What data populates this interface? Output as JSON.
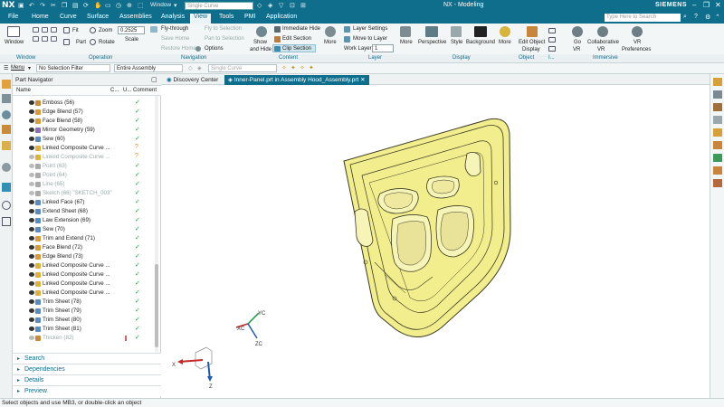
{
  "titlebar": {
    "logo": "NX",
    "window_menu": "Window",
    "curve_filter": "Single Curve",
    "title": "NX - Modeling",
    "brand": "SIEMENS"
  },
  "menu": {
    "tabs": [
      "File",
      "Home",
      "Curve",
      "Surface",
      "Assemblies",
      "Analysis",
      "View",
      "Tools",
      "PMI",
      "Application"
    ],
    "active": "View",
    "search_placeholder": "Type Here to Search"
  },
  "ribbon": {
    "window_label": "Window",
    "fit": "Fit",
    "zoom": "Zoom",
    "scale_value": "0.2525",
    "part": "Part",
    "rotate": "Rotate",
    "scale": "Scale",
    "fly_through": "Fly-through",
    "fly_to_selection": "Fly to Selection",
    "save_home": "Save Home",
    "pan_to_selection": "Pan to Selection",
    "restore_home": "Restore Home",
    "options": "Options",
    "show_and_hide": [
      "Show",
      "and Hide"
    ],
    "immediate_hide": "Immediate Hide",
    "edit_section": "Edit Section",
    "clip_section": "Clip Section",
    "more1": "More",
    "layer_settings": "Layer Settings",
    "move_to_layer": "Move to Layer",
    "work_layer": "Work Layer",
    "work_layer_value": "1",
    "more2": "More",
    "perspective": "Perspective",
    "style": "Style",
    "background": "Background",
    "more3": "More",
    "edit_object_display": [
      "Edit Object",
      "Display"
    ],
    "go_vr": [
      "Go",
      "VR"
    ],
    "collaborative_vr": [
      "Collaborative",
      "VR"
    ],
    "vr_preferences": [
      "VR",
      "Preferences"
    ],
    "groups": [
      "Window",
      "Operation",
      "Navigation",
      "Content",
      "Layer",
      "Display",
      "Object",
      "I...",
      "Immersive"
    ]
  },
  "selection_bar": {
    "menu": "Menu",
    "filter": "No Selection Filter",
    "scope": "Entire Assembly",
    "curve_rule": "Single Curve"
  },
  "navigator": {
    "title": "Part Navigator",
    "columns": [
      "Name",
      "C...",
      "U...",
      "Comment"
    ],
    "rows": [
      {
        "label": "Emboss (56)",
        "state": "ok",
        "color": "#c98b3a"
      },
      {
        "label": "Edge Blend (57)",
        "state": "ok",
        "color": "#d99a3a"
      },
      {
        "label": "Face Blend (58)",
        "state": "ok",
        "color": "#d99a3a"
      },
      {
        "label": "Mirror Geometry (59)",
        "state": "ok",
        "color": "#8a6fb8"
      },
      {
        "label": "Sew (60)",
        "state": "ok",
        "color": "#5a8ac2"
      },
      {
        "label": "Linked Composite Curve ...",
        "state": "warn",
        "color": "#e0b13a"
      },
      {
        "label": "Linked Composite Curve ...",
        "state": "warn",
        "color": "#e0b13a",
        "grey": true
      },
      {
        "label": "Point (63)",
        "state": "ok",
        "color": "#aaaaaa",
        "grey": true
      },
      {
        "label": "Point (64)",
        "state": "ok",
        "color": "#aaaaaa",
        "grey": true
      },
      {
        "label": "Line (65)",
        "state": "ok",
        "color": "#aaaaaa",
        "grey": true
      },
      {
        "label": "Sketch (66) \"SKETCH_003\"",
        "state": "ok",
        "color": "#aaaaaa",
        "grey": true
      },
      {
        "label": "Linked Face (67)",
        "state": "ok",
        "color": "#5a8ac2"
      },
      {
        "label": "Extend Sheet (68)",
        "state": "ok",
        "color": "#5a8ac2"
      },
      {
        "label": "Law Extension (69)",
        "state": "ok",
        "color": "#5a8ac2"
      },
      {
        "label": "Sew (70)",
        "state": "ok",
        "color": "#5a8ac2"
      },
      {
        "label": "Trim and Extend (71)",
        "state": "ok",
        "color": "#d99a3a"
      },
      {
        "label": "Face Blend (72)",
        "state": "ok",
        "color": "#d99a3a"
      },
      {
        "label": "Edge Blend (73)",
        "state": "ok",
        "color": "#d99a3a"
      },
      {
        "label": "Linked Composite Curve ...",
        "state": "ok",
        "color": "#e0b13a"
      },
      {
        "label": "Linked Composite Curve ...",
        "state": "ok",
        "color": "#e0b13a"
      },
      {
        "label": "Linked Composite Curve ...",
        "state": "ok",
        "color": "#e0b13a"
      },
      {
        "label": "Linked Composite Curve ...",
        "state": "ok",
        "color": "#e0b13a"
      },
      {
        "label": "Trim Sheet (78)",
        "state": "ok",
        "color": "#5a8ac2"
      },
      {
        "label": "Trim Sheet (79)",
        "state": "ok",
        "color": "#5a8ac2"
      },
      {
        "label": "Trim Sheet (80)",
        "state": "ok",
        "color": "#5a8ac2"
      },
      {
        "label": "Trim Sheet (81)",
        "state": "ok",
        "color": "#5a8ac2"
      },
      {
        "label": "Thicken (82)",
        "state": "ok",
        "color": "#c98b3a",
        "grey": true,
        "flag": true
      }
    ],
    "panels": [
      "Search",
      "Dependencies",
      "Details",
      "Preview"
    ]
  },
  "graphics_tabs": {
    "discovery": "Discovery Center",
    "part": "Inner-Panel.prt in Assembly Hood_Assembly.prt"
  },
  "triad": {
    "xc": "XC",
    "yc": "YC",
    "zc": "ZC",
    "x": "X",
    "z": "Z"
  },
  "status": "Select objects and use MB3, or double-click an object",
  "colors": {
    "accent": "#0f6e8c",
    "part": "#f3f09a",
    "edge": "#3a3a22"
  }
}
